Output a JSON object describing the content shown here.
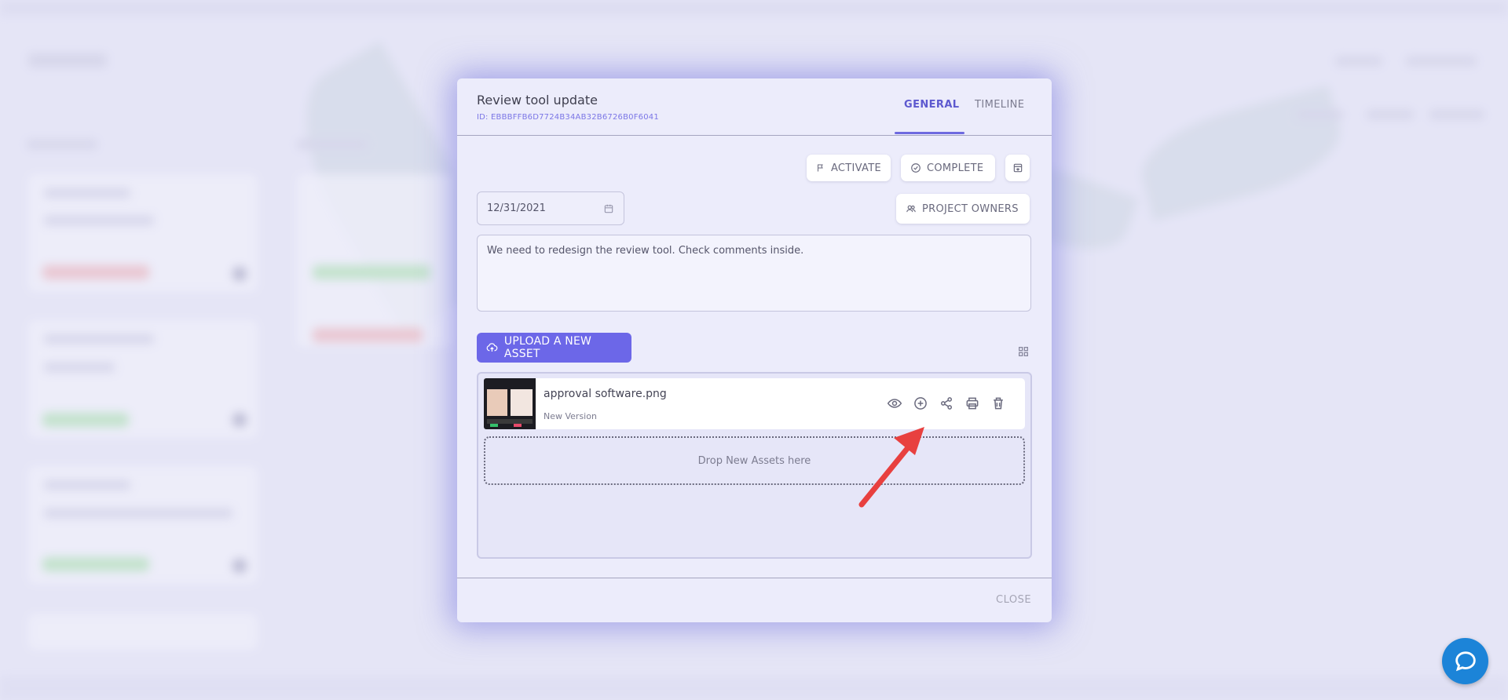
{
  "modal": {
    "title": "Review tool update",
    "id_text": "ID: EBBBFFB6D7724B34AB32B6726B0F6041",
    "tabs": [
      {
        "label": "GENERAL",
        "active": true
      },
      {
        "label": "TIMELINE",
        "active": false
      }
    ],
    "actions": {
      "activate_label": "ACTIVATE",
      "complete_label": "COMPLETE",
      "export_icon": "archive-icon",
      "project_owners_label": "PROJECT OWNERS"
    },
    "date_value": "12/31/2021",
    "description": "We need to redesign the review tool. Check comments inside.",
    "upload_label": "UPLOAD A NEW ASSET",
    "assets": [
      {
        "name": "approval software.png",
        "subtitle": "New Version",
        "row_actions": [
          "eye-icon",
          "plus-circle-icon",
          "share-icon",
          "print-icon",
          "trash-icon"
        ]
      }
    ],
    "dropzone_text": "Drop New Assets here",
    "close_label": "CLOSE"
  },
  "colors": {
    "accent": "#6c67e8",
    "tab_active": "#5d59cf",
    "annotation_arrow": "#e8403f",
    "chat_button": "#1c84d8"
  }
}
